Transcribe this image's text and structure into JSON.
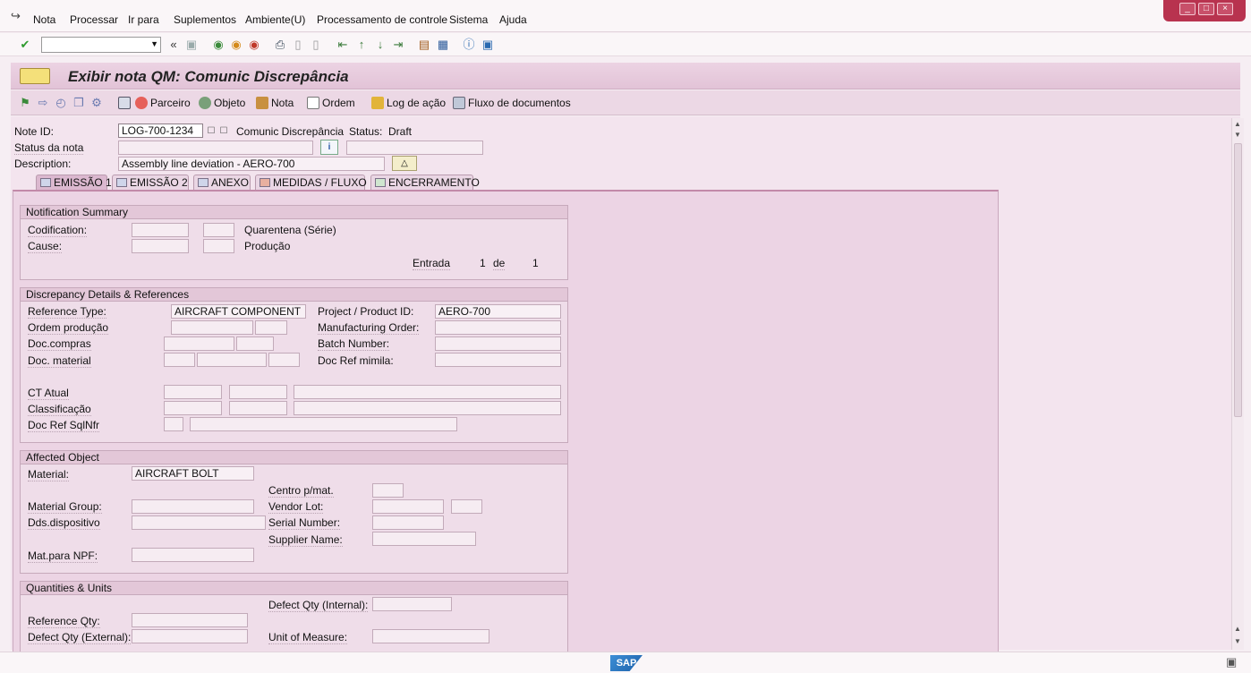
{
  "menu": [
    "Nota",
    "Processar",
    "Ir para",
    "Suplementos",
    "Ambiente(U)",
    "Processamento de controle",
    "Sistema",
    "Ajuda"
  ],
  "window_controls": [
    "_",
    "□",
    "×"
  ],
  "title": "Exibir nota QM: Comunic Discrepância",
  "app_toolbar": {
    "parceiro": "Parceiro",
    "objeto": "Objeto",
    "nota": "Nota",
    "ordem": "Ordem",
    "log": "Log de ação",
    "fluxo": "Fluxo de documentos"
  },
  "header": {
    "note_id_label": "Note ID:",
    "note_id_value": "LOG-700-1234",
    "note_type": "Comunic Discrepância",
    "status_label": "Status:",
    "status_value": "Draft",
    "status_nota_label": "Status da nota",
    "description_label": "Description:",
    "description_value": "Assembly line deviation - AERO-700"
  },
  "tabs": [
    "EMISSÃO 1",
    "EMISSÃO 2",
    "ANEXO",
    "MEDIDAS / FLUXO",
    "ENCERRAMENTO"
  ],
  "summary": {
    "title": "Notification Summary",
    "codification_label": "Codification:",
    "cause_label": "Cause:",
    "quarentena": "Quarentena (Série)",
    "producao": "Produção",
    "entrada_label": "Entrada",
    "entrada_current": "1",
    "de_label": "de",
    "entrada_total": "1"
  },
  "discrepancy": {
    "title": "Discrepancy Details & References",
    "reference_type_label": "Reference Type:",
    "reference_type_value": "AIRCRAFT COMPONENT",
    "project_label": "Project / Product ID:",
    "project_value": "AERO-700",
    "ordem_producao_label": "Ordem produção",
    "manufacturing_order_label": "Manufacturing Order:",
    "doc_compras_label": "Doc.compras",
    "batch_number_label": "Batch Number:",
    "doc_material_label": "Doc. material",
    "doc_ref_label": "Doc Ref mimila:",
    "ct_atual_label": "CT Atual",
    "classificacao_label": "Classificação",
    "doc_ref_sqlnfr_label": "Doc Ref SqlNfr"
  },
  "affected": {
    "title": "Affected Object",
    "material_label": "Material:",
    "material_value": "AIRCRAFT BOLT",
    "centro_label": "Centro p/mat.",
    "material_group_label": "Material Group:",
    "vendor_lot_label": "Vendor Lot:",
    "dds_label": "Dds.dispositivo",
    "serial_label": "Serial Number:",
    "supplier_label": "Supplier Name:",
    "npf_label": "Mat.para NPF:"
  },
  "quantities": {
    "title": "Quantities & Units",
    "defect_internal_label": "Defect Qty (Internal):",
    "reference_qty_label": "Reference Qty:",
    "defect_external_label": "Defect Qty (External):",
    "uom_label": "Unit of Measure:"
  },
  "status_bar": {
    "logo": "SAP"
  }
}
